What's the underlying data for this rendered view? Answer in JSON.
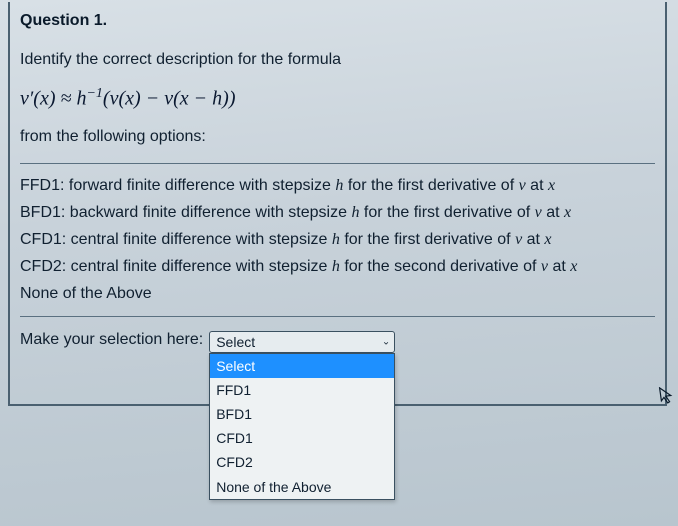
{
  "question": {
    "title": "Question 1.",
    "prompt_intro": "Identify the correct description for the formula",
    "formula_html": "v′(x) ≈ h⁻¹(v(x) − v(x − h))",
    "prompt_after": "from the following options:",
    "options": [
      {
        "code": "FFD1",
        "text": "forward finite difference with stepsize",
        "step": "h",
        "tail1": "for the first derivative of",
        "func": "v",
        "tail2": "at",
        "var": "x"
      },
      {
        "code": "BFD1",
        "text": "backward finite difference with stepsize",
        "step": "h",
        "tail1": "for the first derivative of",
        "func": "v",
        "tail2": "at",
        "var": "x"
      },
      {
        "code": "CFD1",
        "text": "central finite difference with stepsize",
        "step": "h",
        "tail1": "for the first derivative of",
        "func": "v",
        "tail2": "at",
        "var": "x"
      },
      {
        "code": "CFD2",
        "text": "central finite difference with stepsize",
        "step": "h",
        "tail1": "for the second derivative of",
        "func": "v",
        "tail2": "at",
        "var": "x"
      }
    ],
    "none_label": "None of the Above",
    "selection_label": "Make your selection here:",
    "select_current": "Select",
    "dropdown": [
      "Select",
      "FFD1",
      "BFD1",
      "CFD1",
      "CFD2",
      "None of the Above"
    ]
  }
}
